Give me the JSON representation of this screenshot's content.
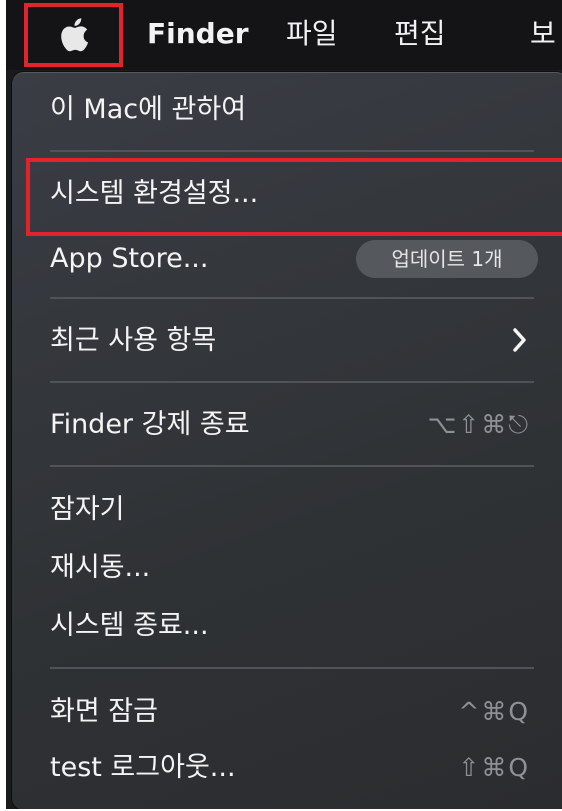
{
  "menubar": {
    "app_name": "Finder",
    "items": [
      "파일",
      "편집",
      "보"
    ]
  },
  "menu": {
    "about": "이 Mac에 관하여",
    "system_prefs": "시스템 환경설정...",
    "app_store": "App Store...",
    "app_store_badge": "업데이트 1개",
    "recent_items": "최근 사용 항목",
    "force_quit": "Finder 강제 종료",
    "force_quit_shortcut": "⌥⇧⌘⎋",
    "sleep": "잠자기",
    "restart": "재시동...",
    "shutdown": "시스템 종료...",
    "lock_screen": "화면 잠금",
    "lock_screen_shortcut": "^⌘Q",
    "logout": "test 로그아웃...",
    "logout_shortcut": "⇧⌘Q"
  },
  "colors": {
    "highlight_border": "#e0232c",
    "menu_background": "#34373c"
  }
}
